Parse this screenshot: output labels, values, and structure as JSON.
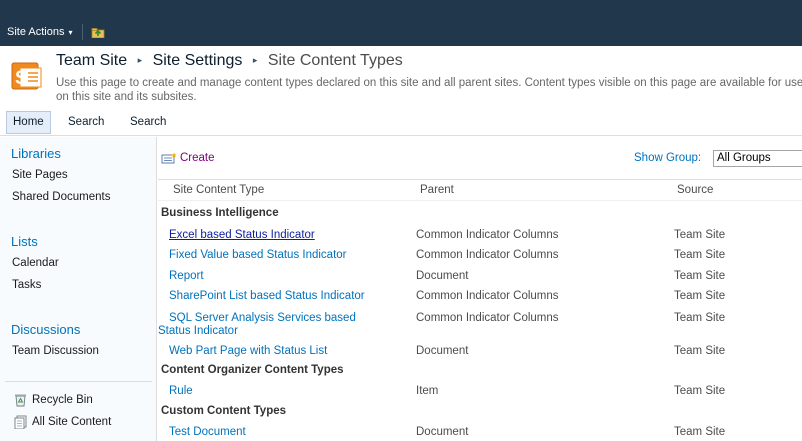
{
  "topbar": {
    "site_actions_label": "Site Actions",
    "caret": "▾"
  },
  "breadcrumb": {
    "site": "Team Site",
    "settings": "Site Settings",
    "current": "Site Content Types",
    "separator": "▸"
  },
  "page_description": "Use this page to create and manage content types declared on this site and all parent sites. Content types visible on this page are available for use on this site and its subsites.",
  "topnav": {
    "items": [
      "Home",
      "Search",
      "Search"
    ]
  },
  "leftnav": {
    "libraries_heading": "Libraries",
    "libraries": [
      "Site Pages",
      "Shared Documents"
    ],
    "lists_heading": "Lists",
    "lists": [
      "Calendar",
      "Tasks"
    ],
    "discussions_heading": "Discussions",
    "discussions": [
      "Team Discussion"
    ],
    "recycle_bin": "Recycle Bin",
    "all_site_content": "All Site Content"
  },
  "toolbar": {
    "create_label": "Create",
    "show_group_label": "Show Group:",
    "group_selected": "All Groups"
  },
  "table": {
    "headers": [
      "Site Content Type",
      "Parent",
      "Source"
    ],
    "groups": [
      {
        "name": "Business Intelligence",
        "rows": [
          {
            "name": "Excel based Status Indicator",
            "parent": "Common Indicator Columns",
            "source": "Team Site"
          },
          {
            "name": "Fixed Value based Status Indicator",
            "parent": "Common Indicator Columns",
            "source": "Team Site"
          },
          {
            "name": "Report",
            "parent": "Document",
            "source": "Team Site"
          },
          {
            "name": "SharePoint List based Status Indicator",
            "parent": "Common Indicator Columns",
            "source": "Team Site"
          },
          {
            "name_line1": "SQL Server Analysis Services based",
            "name_line2": "Status Indicator",
            "parent": "Common Indicator Columns",
            "source": "Team Site"
          },
          {
            "name": "Web Part Page with Status List",
            "parent": "Document",
            "source": "Team Site"
          }
        ]
      },
      {
        "name": "Content Organizer Content Types",
        "rows": [
          {
            "name": "Rule",
            "parent": "Item",
            "source": "Team Site"
          }
        ]
      },
      {
        "name": "Custom Content Types",
        "rows": [
          {
            "name": "Test Document",
            "parent": "Document",
            "source": "Team Site"
          }
        ]
      }
    ]
  },
  "colors": {
    "topbar_bg": "#21374c",
    "link_blue": "#0072bc",
    "create_purple": "#800080"
  },
  "icons": [
    "caret-down-icon",
    "navigate-up-icon",
    "sharepoint-logo-icon",
    "create-icon",
    "recycle-bin-icon",
    "all-site-content-icon"
  ]
}
